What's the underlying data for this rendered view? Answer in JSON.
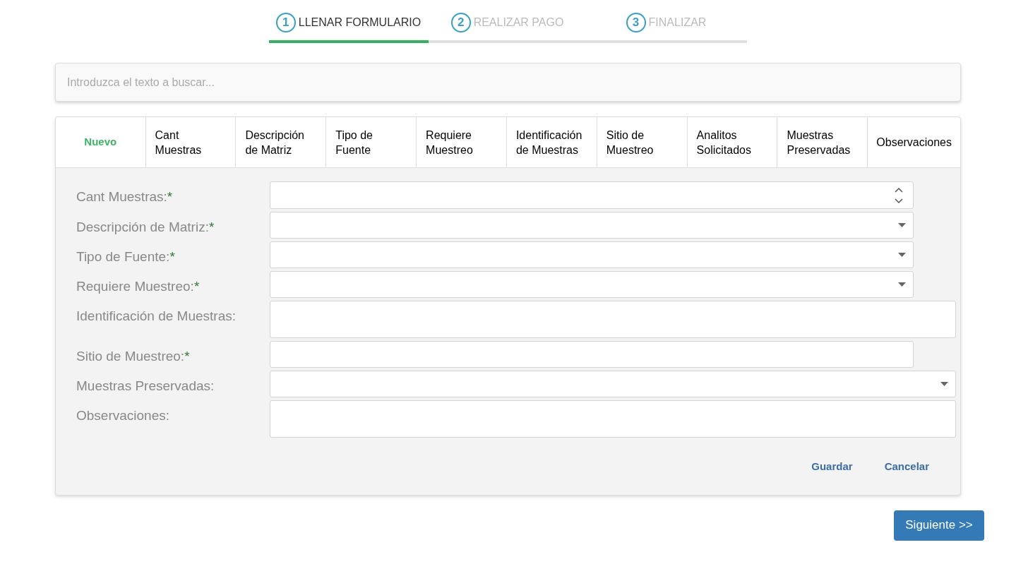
{
  "steps": [
    {
      "number": "1",
      "label": "LLENAR FORMULARIO",
      "selected": true
    },
    {
      "number": "2",
      "label": "REALIZAR PAGO",
      "selected": false
    },
    {
      "number": "3",
      "label": "FINALIZAR",
      "selected": false
    }
  ],
  "search": {
    "placeholder": "Introduzca el texto a buscar..."
  },
  "table": {
    "new_link": "Nuevo",
    "columns": [
      "Cant Muestras",
      "Descripción de Matriz",
      "Tipo de Fuente",
      "Requiere Muestreo",
      "Identificación de Muestras",
      "Sitio de Muestreo",
      "Analitos Solicitados",
      "Muestras Preservadas",
      "Observaciones"
    ]
  },
  "form": {
    "fields": [
      {
        "label": "Cant Muestras:",
        "required": true,
        "kind": "number"
      },
      {
        "label": "Descripción de Matriz:",
        "required": true,
        "kind": "select"
      },
      {
        "label": "Tipo de Fuente:",
        "required": true,
        "kind": "select"
      },
      {
        "label": "Requiere Muestreo:",
        "required": true,
        "kind": "select"
      },
      {
        "label": "Identificación de Muestras:",
        "required": false,
        "kind": "textarea"
      },
      {
        "label": "Sitio de Muestreo:",
        "required": true,
        "kind": "text"
      },
      {
        "label": "Muestras Preservadas:",
        "required": false,
        "kind": "select"
      },
      {
        "label": "Observaciones:",
        "required": false,
        "kind": "textarea"
      }
    ],
    "required_mark": "*",
    "actions": [
      "Guardar",
      "Cancelar"
    ]
  },
  "next_button": "Siguiente >>"
}
